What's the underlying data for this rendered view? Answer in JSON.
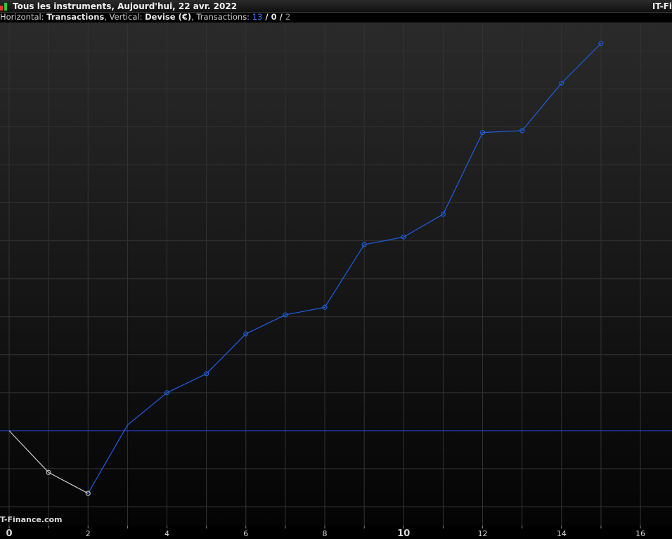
{
  "header": {
    "title": "Tous les instruments, Aujourd'hui, 22 avr. 2022",
    "brand": "IT-Fi"
  },
  "info": {
    "h_label": "Horizontal: ",
    "h_value": "Transactions",
    "v_label": ", Vertical: ",
    "v_value": "Devise (€)",
    "t_label": ", Transactions: ",
    "t_total": "13",
    "sep1": " / ",
    "t_mid": "0",
    "sep2": " / ",
    "t_last": "2"
  },
  "watermark": "T-Finance.com",
  "colors": {
    "profit_line": "#1e5fe0",
    "loss_line": "#c8c8c8",
    "zero_line": "#2a3fd8",
    "grid": "#333333"
  },
  "chart_data": {
    "type": "line",
    "title": "",
    "xlabel": "Transactions",
    "ylabel": "Devise (€)",
    "x_ticks": [
      0,
      2,
      4,
      6,
      8,
      10,
      12,
      14,
      16
    ],
    "xlim": [
      0,
      16.8
    ],
    "ylim": [
      -2.5,
      10.6
    ],
    "y_tick_labels_shown": false,
    "grid": true,
    "zero_line": 0,
    "series": [
      {
        "x": [
          0,
          1,
          2,
          3,
          4,
          5,
          6,
          7,
          8,
          9,
          10,
          11,
          12,
          13,
          14,
          15
        ],
        "y": [
          0,
          -1.1,
          -1.65,
          0.15,
          1.0,
          1.5,
          2.55,
          3.05,
          3.25,
          4.9,
          5.1,
          5.7,
          7.85,
          7.9,
          9.15,
          10.2
        ]
      }
    ]
  }
}
